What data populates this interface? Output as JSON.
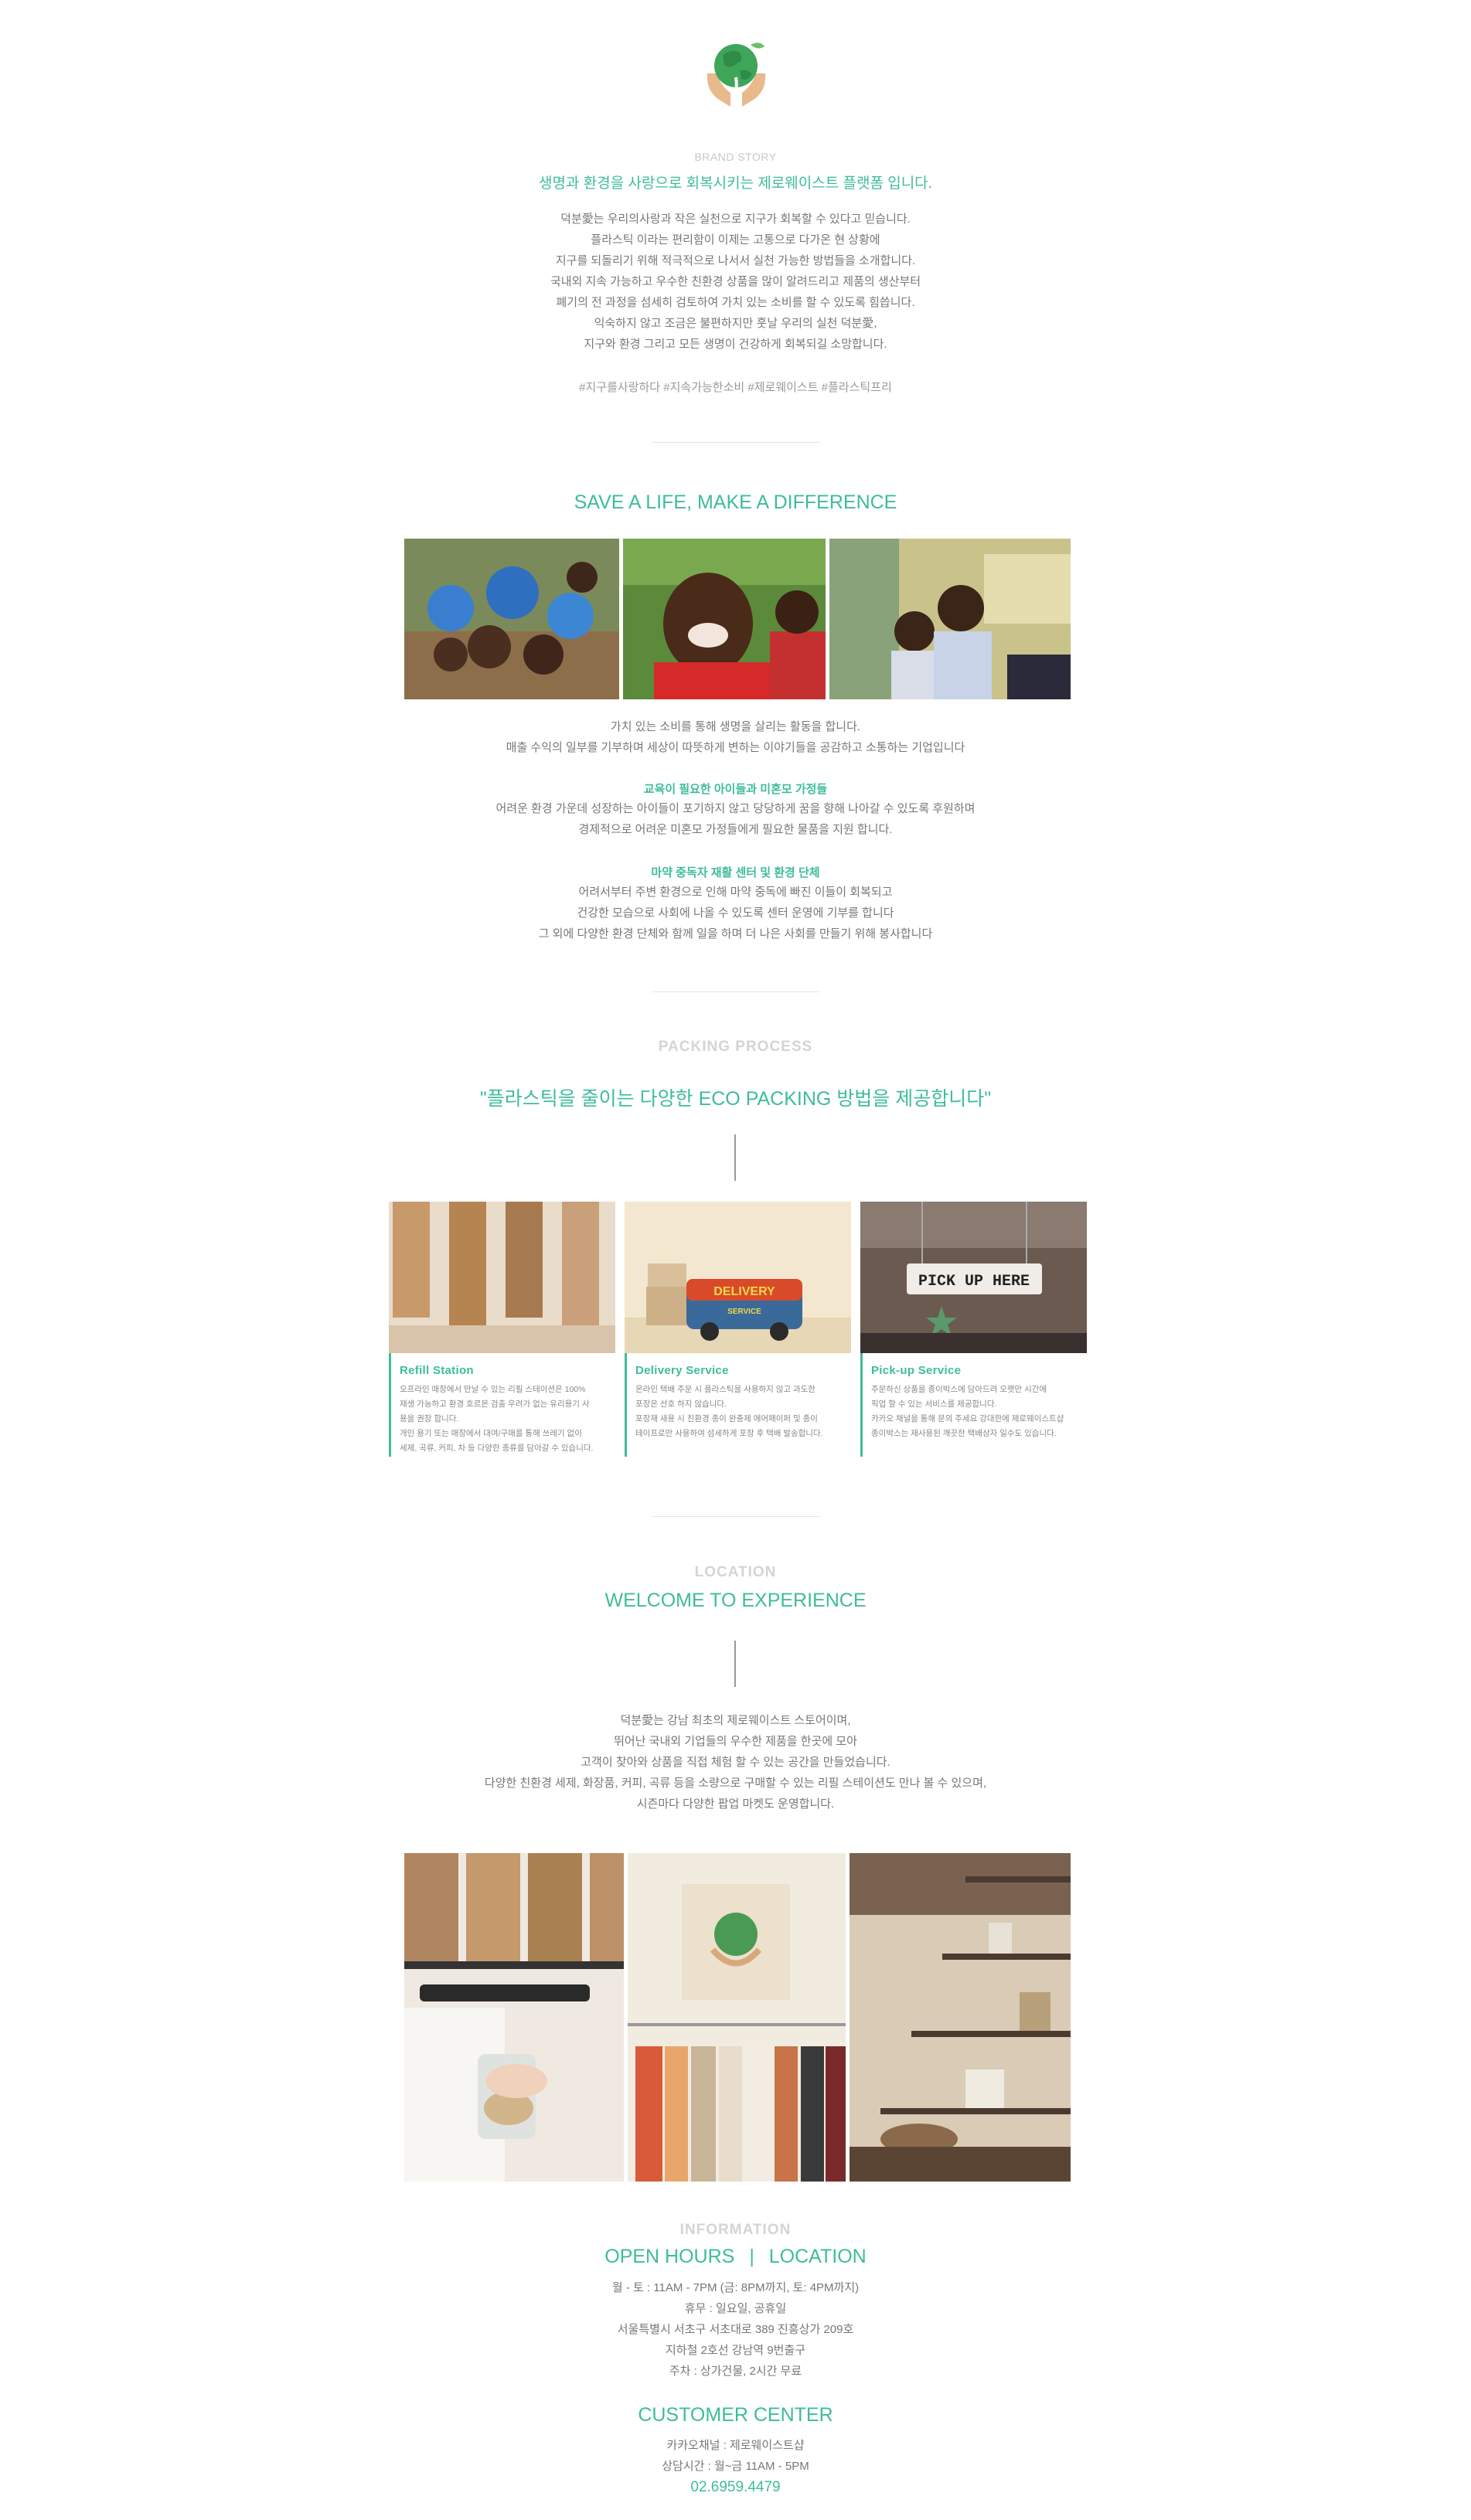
{
  "brand_story": {
    "label": "BRAND STORY",
    "headline": "생명과 환경을 사랑으로 회복시키는 제로웨이스트 플랫폼 입니다.",
    "paragraph": [
      "덕분愛는 우리의사랑과 작은 실천으로 지구가 회복할 수 있다고 믿습니다.",
      "플라스틱 이라는 편리함이 이제는 고통으로 다가온 현 상황에",
      "지구를 되돌리기 위해 적극적으로 나서서 실천 가능한 방법들을 소개합니다.",
      "국내외 지속 가능하고 우수한 친환경 상품을 많이 알려드리고 제품의 생산부터",
      "폐기의 전 과정을 섬세히 검토하여 가치 있는 소비를 할 수 있도록 힘씁니다.",
      "익숙하지 않고 조금은 불편하지만 훗날 우리의 실천 덕분愛,",
      "지구와 환경 그리고 모든 생명이 건강하게 회복되길 소망합니다."
    ],
    "hashtags": "#지구를사랑하다 #지속가능한소비 #제로웨이스트 #플라스틱프리"
  },
  "save_life": {
    "title": "SAVE A LIFE, MAKE A DIFFERENCE",
    "intro": [
      "가치 있는 소비를 통해 생명을 살리는 활동을 합니다.",
      "매출 수익의 일부를 기부하며 세상이 따뜻하게 변하는 이야기들을 공감하고 소통하는 기업입니다"
    ],
    "section1_title": "교육이 필요한 아이들과 미혼모 가정들",
    "section1_text": [
      "어려운 환경 가운데 성장하는 아이들이 포기하지 않고 당당하게 꿈을 향해 나아갈 수 있도록 후원하며",
      "경제적으로 어려운 미혼모 가정들에게 필요한 물품을 지원 합니다."
    ],
    "section2_title": "마약 중독자 재활 센터 및 환경 단체",
    "section2_text": [
      "어려서부터 주변 환경으로 인해 마약 중독에 빠진 이들이 회복되고",
      "건강한 모습으로 사회에 나올 수 있도록 센터 운영에 기부를 합니다",
      "그 외에 다양한 환경 단체와 함께 일을 하며 더 나은 사회를 만들기 위해 봉사합니다"
    ]
  },
  "packing": {
    "label": "PACKING PROCESS",
    "headline": "\"플라스틱을 줄이는 다양한 ECO PACKING 방법을 제공합니다\"",
    "cards": [
      {
        "title": "Refill Station",
        "desc": [
          "오프라인 매장에서 만날 수 있는 리필 스테이션은 100%",
          "재생 가능하고 환경 호르몬 검출 우려가 없는 유리용기 사",
          "용을 권장 합니다.",
          "개인 용기 또는 매장에서 대여/구매를 통해 쓰레기 없이",
          "세제, 곡류, 커피, 차 등 다양한 종류를 담아갈 수 있습니다."
        ]
      },
      {
        "title": "Delivery Service",
        "desc": [
          "온라인 택배 주문 시 플라스틱을 사용하지 않고 과도한",
          "포장은 선호 하지 않습니다.",
          "포장재 새용 시 친환경 종이 완충제 에어패이퍼 및 종이",
          "테이프로만 사용하여 섬세하게 포장 후 택배 발송합니다."
        ]
      },
      {
        "title": "Pick-up Service",
        "desc": [
          "주문하신 상품을 종이박스에 담아드려 오랫만 시간에",
          "픽업 할 수 있는 서비스를 제공합니다.",
          "카카오 채널을 통해 문의 주세요 강대한에 제로웨이스트샵",
          "종이박스는 재사용된 깨끗한 택배상자 일수도 있습니다."
        ]
      }
    ],
    "pickup_sign": "PICK UP HERE",
    "truck_sign_1": "DELIVERY",
    "truck_sign_2": "SERVICE"
  },
  "location": {
    "label": "LOCATION",
    "title": "WELCOME TO EXPERIENCE",
    "paragraph": [
      "덕분愛는 강남 최초의 제로웨이스트 스토어이며,",
      "뛰어난 국내외 기업들의 우수한 제품을 한곳에 모아",
      "고객이 찾아와 상품을 직접 체험 할 수 있는 공간을 만들었습니다.",
      "다양한 친환경 세제, 화장품, 커피, 곡류 등을 소량으로 구매할 수 있는 리필 스테이션도 만나 볼 수 있으며,",
      "시즌마다 다양한 팝업 마켓도 운영합니다."
    ]
  },
  "information": {
    "label": "INFORMATION",
    "title_left": "OPEN HOURS",
    "separator": "|",
    "title_right": "LOCATION",
    "lines": [
      "월 - 토 : 11AM - 7PM (금: 8PM까지, 토: 4PM까지)",
      "휴무 : 일요일, 공휴일",
      "서울특별시 서초구 서초대로 389 진흥상가 209호",
      "지하철 2호선 강남역 9번출구",
      "주차 : 상가건물, 2시간 무료"
    ],
    "customer_title": "CUSTOMER CENTER",
    "customer_lines": [
      "카카오채널 : 제로웨이스트샵",
      "상담시간 : 월~금 11AM - 5PM"
    ],
    "phone": "02.6959.4479"
  },
  "colors": {
    "accent": "#3dbd9a",
    "muted": "#777777",
    "light_label": "#cccccc"
  }
}
